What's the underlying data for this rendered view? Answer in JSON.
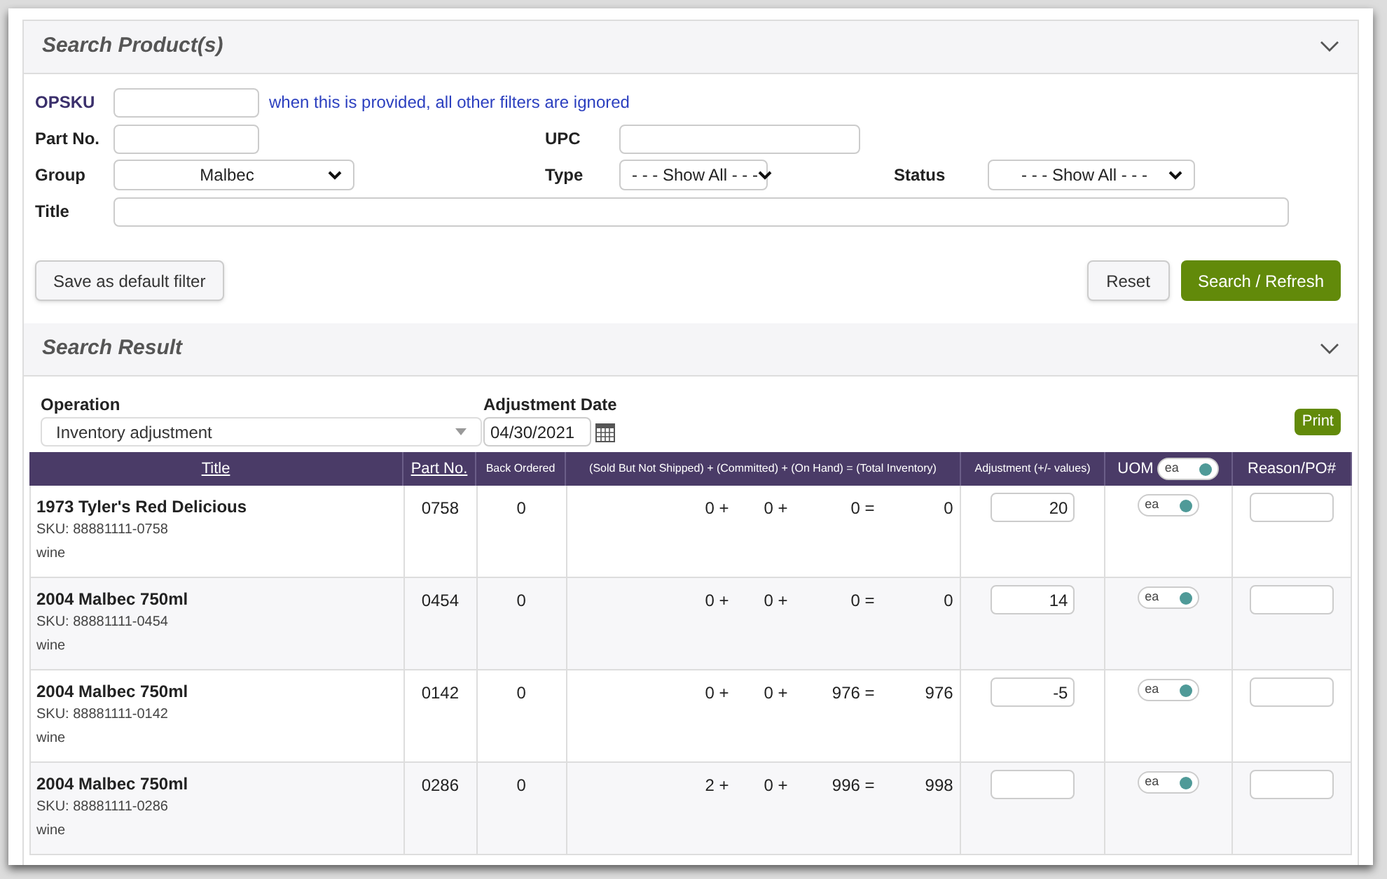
{
  "search_panel": {
    "title": "Search Product(s)",
    "opsku": {
      "label": "OPSKU",
      "hint": "when this is provided, all other filters are ignored"
    },
    "part_no": {
      "label": "Part No."
    },
    "upc": {
      "label": "UPC"
    },
    "group": {
      "label": "Group",
      "value": "Malbec"
    },
    "type": {
      "label": "Type",
      "value": "- - - Show All - - -"
    },
    "status": {
      "label": "Status",
      "value": "- - - Show All - - -"
    },
    "title_field": {
      "label": "Title"
    },
    "buttons": {
      "save_default": "Save as default filter",
      "reset": "Reset",
      "search": "Search / Refresh"
    }
  },
  "result_panel": {
    "title": "Search Result",
    "operation": {
      "label": "Operation",
      "value": "Inventory adjustment"
    },
    "adjustment_date": {
      "label": "Adjustment Date",
      "value": "04/30/2021"
    },
    "print": "Print",
    "table": {
      "columns": [
        {
          "label": "Title",
          "kind": "link"
        },
        {
          "label": "Part No.",
          "kind": "link"
        },
        {
          "label": "Back Ordered",
          "kind": "small"
        },
        {
          "label": "(Sold But Not Shipped) + (Committed) + (On Hand) = (Total Inventory)",
          "kind": "small"
        },
        {
          "label": "Adjustment (+/- values)",
          "kind": "small"
        },
        {
          "label": "UOM",
          "kind": "plain",
          "toggle": {
            "label": "ea",
            "on": true
          }
        },
        {
          "label": "Reason/PO#",
          "kind": "plain"
        }
      ],
      "rows": [
        {
          "title": "1973 Tyler's Red Delicious",
          "sku": "SKU: 88881111-0758",
          "category": "wine",
          "part_no": "0758",
          "back_ordered": "0",
          "formula": [
            "0 +",
            "0 +",
            "0 =",
            "0"
          ],
          "adjustment": "20",
          "uom": {
            "label": "ea",
            "on": true
          }
        },
        {
          "title": "2004 Malbec 750ml",
          "sku": "SKU: 88881111-0454",
          "category": "wine",
          "part_no": "0454",
          "back_ordered": "0",
          "formula": [
            "0 +",
            "0 +",
            "0 =",
            "0"
          ],
          "adjustment": "14",
          "uom": {
            "label": "ea",
            "on": true
          }
        },
        {
          "title": "2004 Malbec 750ml",
          "sku": "SKU: 88881111-0142",
          "category": "wine",
          "part_no": "0142",
          "back_ordered": "0",
          "formula": [
            "0 +",
            "0 +",
            "976 =",
            "976"
          ],
          "adjustment": "-5",
          "uom": {
            "label": "ea",
            "on": true
          }
        },
        {
          "title": "2004 Malbec 750ml",
          "sku": "SKU: 88881111-0286",
          "category": "wine",
          "part_no": "0286",
          "back_ordered": "0",
          "formula": [
            "2 +",
            "0 +",
            "996 =",
            "998"
          ],
          "adjustment": "",
          "uom": {
            "label": "ea",
            "on": true
          }
        }
      ]
    }
  }
}
